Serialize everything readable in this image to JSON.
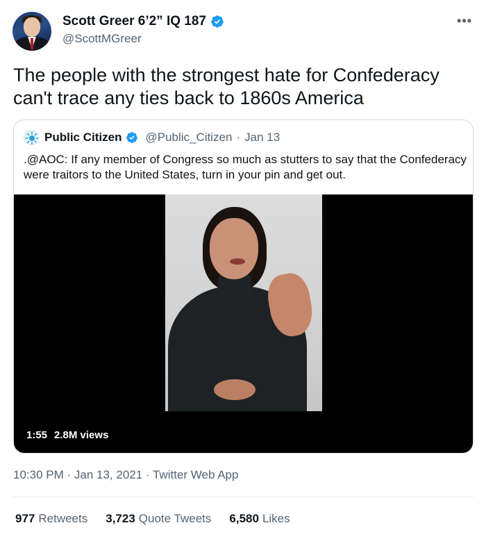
{
  "author": {
    "display_name": "Scott Greer 6’2” IQ 187",
    "handle": "@ScottMGreer",
    "verified": true
  },
  "more_icon": "•••",
  "tweet_text": "The people with the strongest hate for Confederacy can't trace any ties back to 1860s America",
  "quoted_tweet": {
    "display_name": "Public Citizen",
    "handle": "@Public_Citizen",
    "separator": "·",
    "date": "Jan 13",
    "text": ".@AOC: If any member of Congress so much as stutters to say that the Confederacy were traitors to the United States, turn in your pin and get out.",
    "video": {
      "duration": "1:55",
      "views": "2.8M views"
    }
  },
  "timestamp": "10:30 PM · Jan 13, 2021 · Twitter Web App",
  "stats": {
    "retweets_count": "977",
    "retweets_label": "Retweets",
    "quotes_count": "3,723",
    "quotes_label": "Quote Tweets",
    "likes_count": "6,580",
    "likes_label": "Likes"
  },
  "colors": {
    "verified_blue": "#1d9bf0",
    "secondary_text": "#536471",
    "primary_text": "#0f1419",
    "border": "#cfd9de"
  }
}
